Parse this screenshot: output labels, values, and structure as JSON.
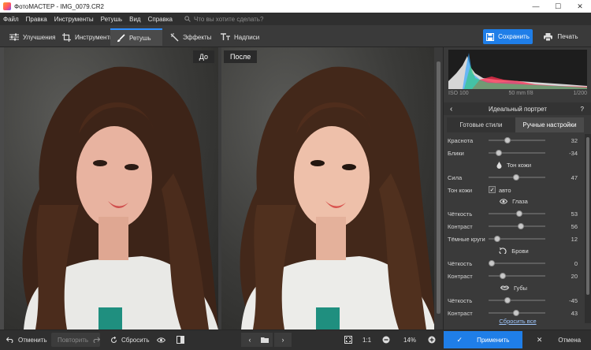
{
  "window": {
    "title": "ФотоМАСТЕР - IMG_0079.CR2"
  },
  "menu": {
    "items": [
      "Файл",
      "Правка",
      "Инструменты",
      "Ретушь",
      "Вид",
      "Справка"
    ],
    "search_placeholder": "Что вы хотите сделать?"
  },
  "toolbar": {
    "tabs": [
      {
        "label": "Улучшения",
        "icon": "sliders-icon"
      },
      {
        "label": "Инструменты",
        "icon": "crop-icon"
      },
      {
        "label": "Ретушь",
        "icon": "brush-icon",
        "active": true
      },
      {
        "label": "Эффекты",
        "icon": "magic-wand-icon"
      },
      {
        "label": "Надписи",
        "icon": "text-icon"
      }
    ],
    "save_label": "Сохранить",
    "print_label": "Печать"
  },
  "canvas": {
    "before_label": "До",
    "after_label": "После"
  },
  "panel": {
    "exif": {
      "iso": "ISO 100",
      "lens": "50 mm f/8",
      "shutter": "1/200"
    },
    "title": "Идеальный портрет",
    "help": "?",
    "tabs": [
      "Готовые стили",
      "Ручные настройки"
    ],
    "rows": {
      "redness": {
        "label": "Краснота",
        "value": "32"
      },
      "shine": {
        "label": "Блики",
        "value": "-34"
      },
      "skin_section": "Тон кожи",
      "strength": {
        "label": "Сила",
        "value": "47"
      },
      "skin_tone": {
        "label": "Тон кожи",
        "checkbox_label": "авто"
      },
      "eyes_section": "Глаза",
      "eyes_sharpness": {
        "label": "Чёткость",
        "value": "53"
      },
      "eyes_contrast": {
        "label": "Контраст",
        "value": "56"
      },
      "dark_circles": {
        "label": "Тёмные круги",
        "value": "12"
      },
      "brows_section": "Брови",
      "brows_sharpness": {
        "label": "Чёткость",
        "value": "0"
      },
      "brows_contrast": {
        "label": "Контраст",
        "value": "20"
      },
      "lips_section": "Губы",
      "lips_sharpness": {
        "label": "Чёткость",
        "value": "-45"
      },
      "lips_contrast": {
        "label": "Контраст",
        "value": "43"
      }
    },
    "reset_all": "Сбросить все"
  },
  "bottom": {
    "undo": "Отменить",
    "redo": "Повторить",
    "reset": "Сбросить",
    "ratio": "1:1",
    "zoom": "14%",
    "apply": "Применить",
    "cancel": "Отмена"
  },
  "colors": {
    "accent": "#1f7ee8",
    "panel": "#3a3a3a",
    "background": "#2b2b2b"
  }
}
